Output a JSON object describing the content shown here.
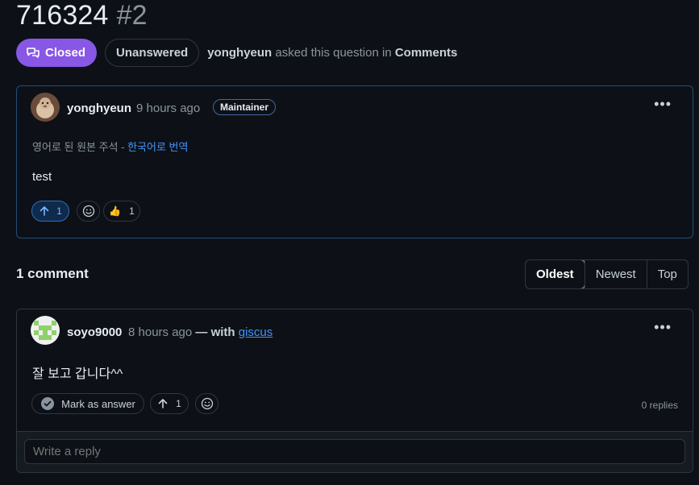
{
  "discussion": {
    "title": "716324",
    "number": "#2",
    "state_label": "Closed",
    "answer_label": "Unanswered",
    "asked_author": "yonghyeun",
    "asked_text": " asked this question in ",
    "category": "Comments"
  },
  "post": {
    "author": "yonghyeun",
    "time": "9 hours ago",
    "role_badge": "Maintainer",
    "menu": "•••",
    "translation_prefix": "영어로 된 원본 주석 - ",
    "translation_link": "한국어로 번역",
    "body": "test",
    "upvotes": "1",
    "thumbs_count": "1",
    "thumbs_emoji": "👍"
  },
  "comments_section": {
    "heading": "1 comment",
    "sort_options": [
      "Oldest",
      "Newest",
      "Top"
    ]
  },
  "comment": {
    "author": "soyo9000",
    "time": "8 hours ago",
    "with_text": " — with ",
    "with_link": "giscus",
    "menu": "•••",
    "body": "잘 보고 갑니다^^",
    "mark_answer": "Mark as answer",
    "upvotes": "1",
    "replies": "0 replies",
    "reply_placeholder": "Write a reply"
  },
  "colors": {
    "accent_purple": "#8957e5",
    "link_blue": "#4493f8",
    "background": "#0d1117"
  }
}
